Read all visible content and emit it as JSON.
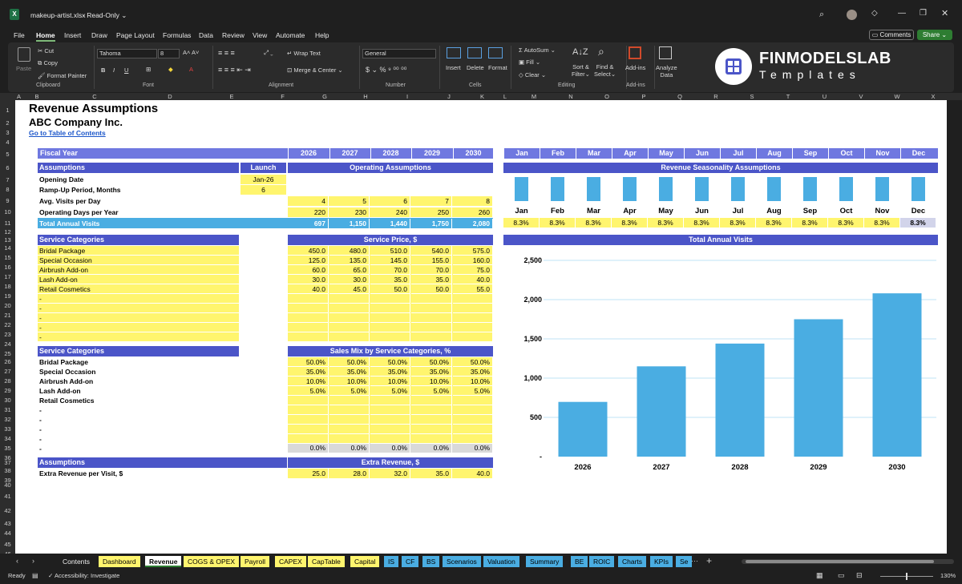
{
  "app": {
    "filename": "makeup-artist.xlsx",
    "readonly": "Read-Only"
  },
  "menu": [
    "File",
    "Home",
    "Insert",
    "Draw",
    "Page Layout",
    "Formulas",
    "Data",
    "Review",
    "View",
    "Automate",
    "Help"
  ],
  "top_buttons": {
    "comments": "Comments",
    "share": "Share"
  },
  "ribbon": {
    "clipboard": {
      "paste": "Paste",
      "cut": "Cut",
      "copy": "Copy",
      "format_painter": "Format Painter",
      "label": "Clipboard"
    },
    "font": {
      "name": "Tahoma",
      "size": "8",
      "label": "Font"
    },
    "alignment": {
      "wrap": "Wrap Text",
      "merge": "Merge & Center",
      "label": "Alignment"
    },
    "number": {
      "format": "General",
      "label": "Number"
    },
    "cells": {
      "insert": "Insert",
      "delete": "Delete",
      "format": "Format",
      "label": "Cells"
    },
    "editing": {
      "autosum": "AutoSum",
      "fill": "Fill",
      "clear": "Clear",
      "sort1": "Sort &",
      "sort2": "Filter",
      "find1": "Find &",
      "find2": "Select",
      "label": "Editing"
    },
    "addins": {
      "btn": "Add-ins",
      "label": "Add-ins"
    },
    "analyze": {
      "l1": "Analyze",
      "l2": "Data"
    }
  },
  "logo": {
    "main": "FINMODELSLAB",
    "sub": "Templates"
  },
  "columns": [
    "A",
    "B",
    "C",
    "D",
    "E",
    "F",
    "G",
    "H",
    "I",
    "J",
    "K",
    "L",
    "M",
    "N",
    "O",
    "P",
    "Q",
    "R",
    "S",
    "T",
    "U",
    "V",
    "W",
    "X"
  ],
  "sheet": {
    "title": "Revenue Assumptions",
    "company": "ABC Company Inc.",
    "toc": "Go to Table of Contents",
    "fiscal_year": "Fiscal Year",
    "years": [
      "2026",
      "2027",
      "2028",
      "2029",
      "2030"
    ],
    "months": [
      "Jan",
      "Feb",
      "Mar",
      "Apr",
      "May",
      "Jun",
      "Jul",
      "Aug",
      "Sep",
      "Oct",
      "Nov",
      "Dec"
    ],
    "assumptions": "Assumptions",
    "launch": "Launch",
    "operating": "Operating Assumptions",
    "seasonality": "Revenue Seasonality Assumptions",
    "opening_date": "Opening Date",
    "opening_val": "Jan-26",
    "ramp": "Ramp-Up Period, Months",
    "ramp_val": "6",
    "visits_day": "Avg. Visits per Day",
    "visits_day_vals": [
      "4",
      "5",
      "6",
      "7",
      "8"
    ],
    "op_days": "Operating Days per Year",
    "op_days_vals": [
      "220",
      "230",
      "240",
      "250",
      "260"
    ],
    "total_visits": "Total Annual Visits",
    "total_visits_vals": [
      "697",
      "1,150",
      "1,440",
      "1,750",
      "2,080"
    ],
    "season_vals": [
      "8.3%",
      "8.3%",
      "8.3%",
      "8.3%",
      "8.3%",
      "8.3%",
      "8.3%",
      "8.3%",
      "8.3%",
      "8.3%",
      "8.3%",
      "8.3%"
    ],
    "season_fraction": [
      0.083,
      0.083,
      0.083,
      0.083,
      0.083,
      0.083,
      0.083,
      0.083,
      0.083,
      0.083,
      0.083,
      0.083
    ],
    "service_cat": "Service Categories",
    "service_price": "Service Price, $",
    "services": [
      "Bridal Package",
      "Special Occasion",
      "Airbrush Add-on",
      "Lash Add-on",
      "Retail Cosmetics",
      "-",
      "-",
      "-",
      "-",
      "-"
    ],
    "prices": [
      [
        "450.0",
        "480.0",
        "510.0",
        "540.0",
        "575.0"
      ],
      [
        "125.0",
        "135.0",
        "145.0",
        "155.0",
        "160.0"
      ],
      [
        "60.0",
        "65.0",
        "70.0",
        "70.0",
        "75.0"
      ],
      [
        "30.0",
        "30.0",
        "35.0",
        "35.0",
        "40.0"
      ],
      [
        "40.0",
        "45.0",
        "50.0",
        "50.0",
        "55.0"
      ],
      [
        "",
        "",
        "",
        "",
        ""
      ],
      [
        "",
        "",
        "",
        "",
        ""
      ],
      [
        "",
        "",
        "",
        "",
        ""
      ],
      [
        "",
        "",
        "",
        "",
        ""
      ],
      [
        "",
        "",
        "",
        "",
        ""
      ]
    ],
    "sales_mix_title": "Sales Mix by Service Categories, %",
    "mix_services": [
      "Bridal Package",
      "Special Occasion",
      "Airbrush Add-on",
      "Lash Add-on",
      "Retail Cosmetics",
      "-",
      "-",
      "-",
      "-",
      "-"
    ],
    "mix": [
      [
        "50.0%",
        "50.0%",
        "50.0%",
        "50.0%",
        "50.0%"
      ],
      [
        "35.0%",
        "35.0%",
        "35.0%",
        "35.0%",
        "35.0%"
      ],
      [
        "10.0%",
        "10.0%",
        "10.0%",
        "10.0%",
        "10.0%"
      ],
      [
        "5.0%",
        "5.0%",
        "5.0%",
        "5.0%",
        "5.0%"
      ],
      [
        "",
        "",
        "",
        "",
        ""
      ],
      [
        "",
        "",
        "",
        "",
        ""
      ],
      [
        "",
        "",
        "",
        "",
        ""
      ],
      [
        "",
        "",
        "",
        "",
        ""
      ],
      [
        "",
        "",
        "",
        "",
        ""
      ],
      [
        "",
        "",
        "",
        "",
        ""
      ]
    ],
    "mix_total": [
      "0.0%",
      "0.0%",
      "0.0%",
      "0.0%",
      "0.0%"
    ],
    "extra_title": "Extra Revenue, $",
    "extra_label": "Extra Revenue per Visit, $",
    "extra_vals": [
      "25.0",
      "28.0",
      "32.0",
      "35.0",
      "40.0"
    ],
    "rows": [
      "1",
      "2",
      "3",
      "4",
      "5",
      "6",
      "7",
      "8",
      "9",
      "10",
      "11",
      "12",
      "13",
      "14",
      "15",
      "16",
      "17",
      "18",
      "19",
      "20",
      "21",
      "22",
      "23",
      "24",
      "25",
      "26",
      "27",
      "28",
      "29",
      "30",
      "31",
      "32",
      "33",
      "34",
      "35",
      "36",
      "37",
      "38",
      "39",
      "40",
      "41",
      "42",
      "43",
      "44",
      "45",
      "46",
      "47"
    ]
  },
  "chart_data": {
    "type": "bar",
    "title": "Total Annual Visits",
    "categories": [
      "2026",
      "2027",
      "2028",
      "2029",
      "2030"
    ],
    "values": [
      697,
      1150,
      1440,
      1750,
      2080
    ],
    "yticks": [
      "2,500",
      "2,000",
      "1,500",
      "1,000",
      "500",
      "-"
    ],
    "ylim": [
      0,
      2500
    ],
    "color": "#4aade2"
  },
  "tabs": [
    "Contents",
    "Dashboard",
    "Revenue",
    "COGS & OPEX",
    "Payroll",
    "CAPEX",
    "CapTable",
    "Capital",
    "IS",
    "CF",
    "BS",
    "Scenarios",
    "Valuation",
    "Summary",
    "BE",
    "ROIC",
    "Charts",
    "KPIs",
    "Se"
  ],
  "status": {
    "ready": "Ready",
    "access": "Accessibility: Investigate",
    "zoom": "130%"
  }
}
